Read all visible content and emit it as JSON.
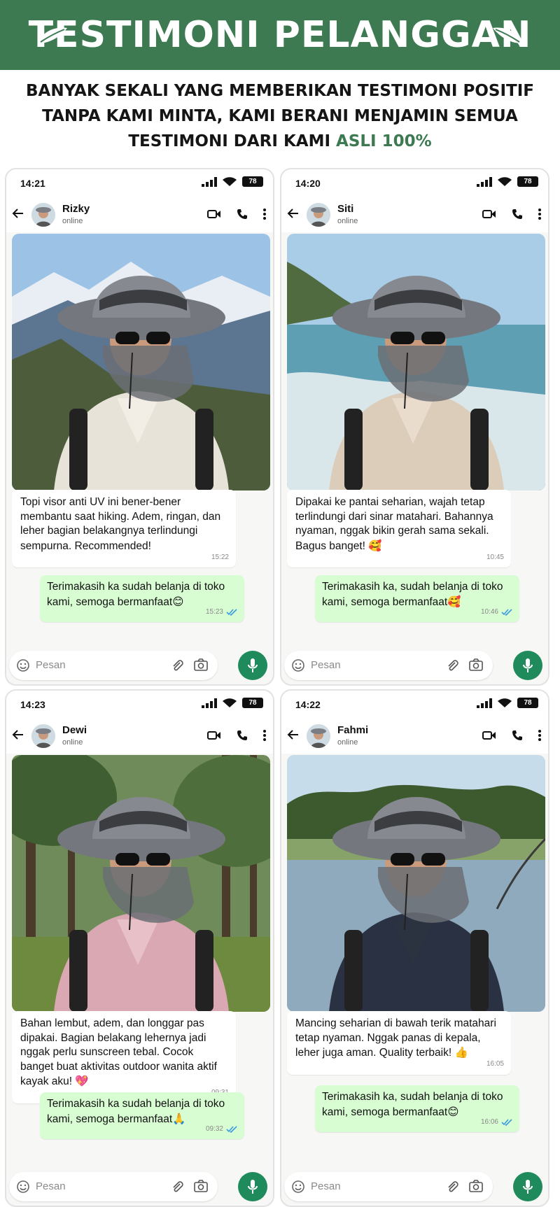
{
  "banner": {
    "title": "TESTIMONI PELANGGAN",
    "color": "#3d7a52"
  },
  "subtitle": {
    "line1": "BANYAK SEKALI YANG MEMBERIKAN TESTIMONI POSITIF",
    "line2": "TANPA KAMI MINTA, KAMI BERANI MENJAMIN SEMUA",
    "line3_prefix": "TESTIMONI DARI KAMI ",
    "line3_highlight": "ASLI 100%"
  },
  "input_placeholder": "Pesan",
  "battery": "78",
  "chats": [
    {
      "time": "14:21",
      "name": "Rizky",
      "status": "online",
      "scene": "mountain",
      "photo_alt": "mountain hiker with grey sun hat",
      "incoming": "Topi visor anti UV ini bener-bener membantu saat hiking. Adem, ringan, dan leher bagian belakangnya terlindungi sempurna. Recommended!",
      "incoming_emoji": "",
      "incoming_time": "15:22",
      "reply": "Terimakasih ka sudah belanja di toko kami, semoga bermanfaat",
      "reply_emoji": "😊",
      "reply_time": "15:23"
    },
    {
      "time": "14:20",
      "name": "Siti",
      "status": "online",
      "scene": "beach",
      "incoming": "Dipakai ke pantai seharian, wajah tetap terlindungi dari sinar matahari. Bahannya nyaman, nggak bikin gerah sama sekali. Bagus banget!",
      "incoming_emoji": "🥰",
      "incoming_time": "10:45",
      "reply": "Terimakasih ka, sudah belanja di toko kami, semoga bermanfaat",
      "reply_emoji": "🥰",
      "reply_time": "10:46"
    },
    {
      "time": "14:23",
      "name": "Dewi",
      "status": "online",
      "scene": "forest",
      "incoming": "Bahan lembut, adem, dan longgar pas dipakai. Bagian belakang lehernya jadi nggak perlu sunscreen tebal. Cocok banget buat aktivitas outdoor wanita aktif kayak aku!",
      "incoming_emoji": "💖",
      "incoming_time": "09:31",
      "reply": "Terimakasih ka sudah belanja di toko kami, semoga bermanfaat",
      "reply_emoji": "🙏",
      "reply_time": "09:32"
    },
    {
      "time": "14:22",
      "name": "Fahmi",
      "status": "online",
      "scene": "lake",
      "incoming": "Mancing seharian di bawah terik matahari tetap nyaman. Nggak panas di kepala, leher juga aman. Quality terbaik!",
      "incoming_emoji": "👍",
      "incoming_time": "16:05",
      "reply": "Terimakasih ka, sudah belanja di toko kami, semoga bermanfaat",
      "reply_emoji": "😊",
      "reply_time": "16:06"
    }
  ]
}
